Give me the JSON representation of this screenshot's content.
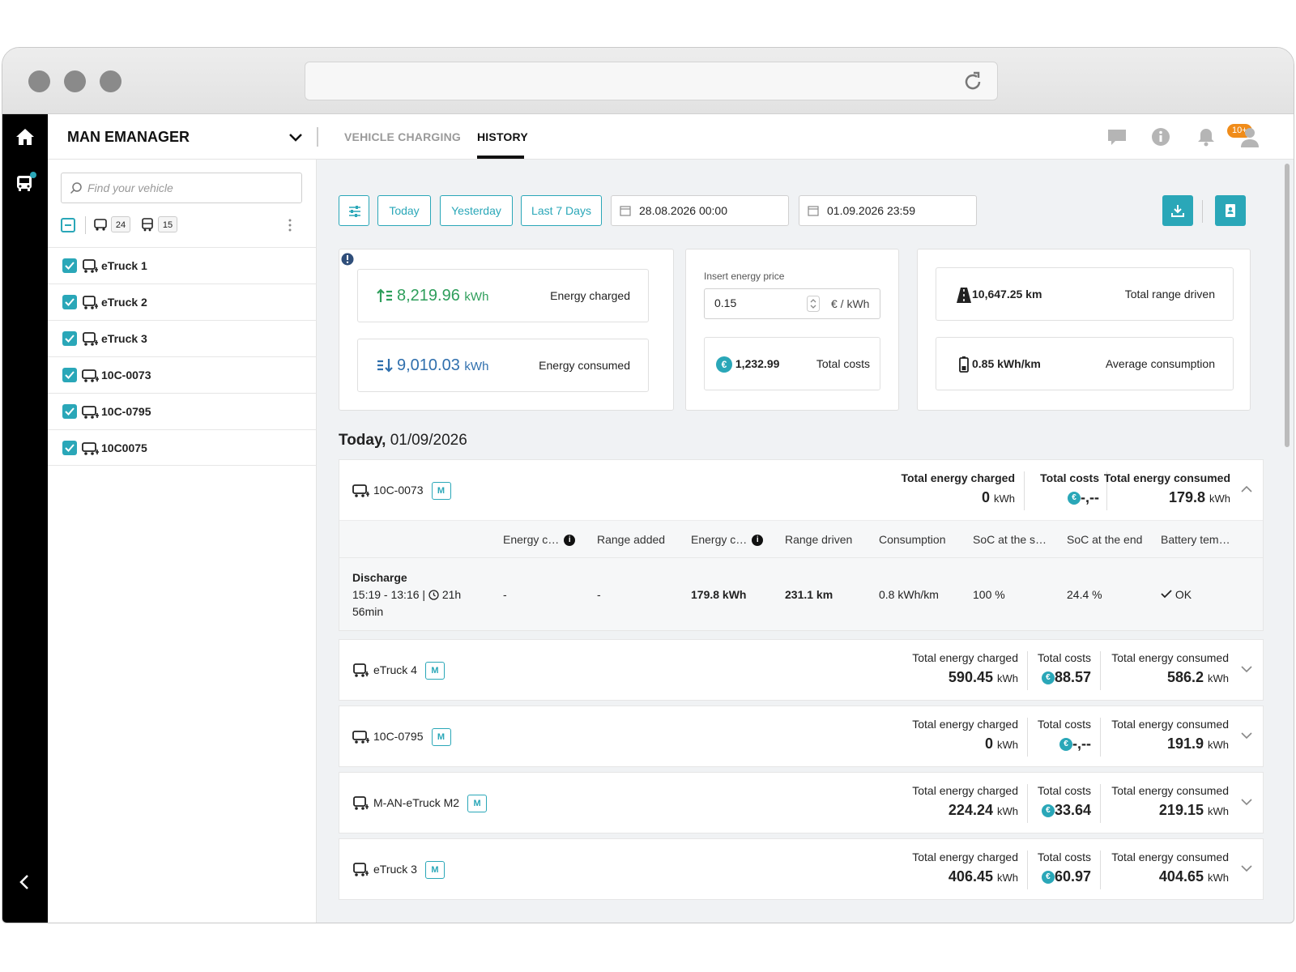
{
  "app": {
    "brand": "MAN EMANAGER",
    "notification_badge": "10+"
  },
  "tabs": [
    {
      "label": "VEHICLE CHARGING",
      "active": false
    },
    {
      "label": "HISTORY",
      "active": true
    }
  ],
  "sidebar": {
    "search_placeholder": "Find your vehicle",
    "truck_count": "24",
    "bus_count": "15",
    "vehicles": [
      "eTruck 1",
      "eTruck 2",
      "eTruck 3",
      "10C-0073",
      "10C-0795",
      "10C0075"
    ]
  },
  "toolbar": {
    "quick_filters": [
      "Today",
      "Yesterday",
      "Last 7 Days"
    ],
    "date_from": "28.08.2026 00:00",
    "date_to": "01.09.2026 23:59"
  },
  "summary": {
    "energy_charged": {
      "value": "8,219.96",
      "unit": "kWh",
      "label": "Energy charged"
    },
    "energy_consumed": {
      "value": "9,010.03",
      "unit": "kWh",
      "label": "Energy consumed"
    },
    "price_label": "Insert energy price",
    "price_value": "0.15",
    "price_unit": "€ / kWh",
    "total_costs": {
      "value": "1,232.99",
      "label": "Total costs"
    },
    "range": {
      "value": "10,647.25 km",
      "label": "Total range driven"
    },
    "avg": {
      "value": "0.85 kWh/km",
      "label": "Average consumption"
    }
  },
  "day": {
    "prefix": "Today,",
    "date": "01/09/2026"
  },
  "totals_labels": {
    "charged": "Total energy charged",
    "costs": "Total costs",
    "consumed": "Total energy consumed",
    "unit": "kWh"
  },
  "tag": "M",
  "columns": [
    "Energy c…",
    "Range added",
    "Energy c…",
    "Range driven",
    "Consumption",
    "SoC at the s…",
    "SoC at the end",
    "Battery tem…"
  ],
  "detail_row": {
    "type": "Discharge",
    "time": "15:19 - 13:16 |",
    "duration": "21h",
    "duration_rest": "56min",
    "energy_charged": "-",
    "range_added": "-",
    "energy_consumed": "179.8 kWh",
    "range_driven": "231.1 km",
    "consumption": "0.8 kWh/km",
    "soc_start": "100 %",
    "soc_end": "24.4 %",
    "battery": "OK"
  },
  "groups": [
    {
      "name": "10C-0073",
      "charged": "0",
      "costs": "-,--",
      "consumed": "179.8"
    },
    {
      "name": "eTruck 4",
      "charged": "590.45",
      "costs": "88.57",
      "consumed": "586.2"
    },
    {
      "name": "10C-0795",
      "charged": "0",
      "costs": "-,--",
      "consumed": "191.9"
    },
    {
      "name": "M-AN-eTruck M2",
      "charged": "224.24",
      "costs": "33.64",
      "consumed": "219.15"
    },
    {
      "name": "eTruck 3",
      "charged": "406.45",
      "costs": "60.97",
      "consumed": "404.65"
    }
  ],
  "colors": {
    "accent": "#2aa7b8",
    "green": "#2e9e5b",
    "blue": "#2f6fad",
    "badge": "#f08c1a"
  },
  "icons": [
    "home-icon",
    "truck-icon",
    "chevron-down-icon",
    "chat-icon",
    "info-icon",
    "bell-icon",
    "user-icon",
    "search-icon",
    "calendar-icon",
    "download-icon",
    "report-icon",
    "euro-icon",
    "road-icon",
    "battery-icon",
    "clock-icon",
    "check-icon",
    "reload-icon",
    "back-icon"
  ]
}
